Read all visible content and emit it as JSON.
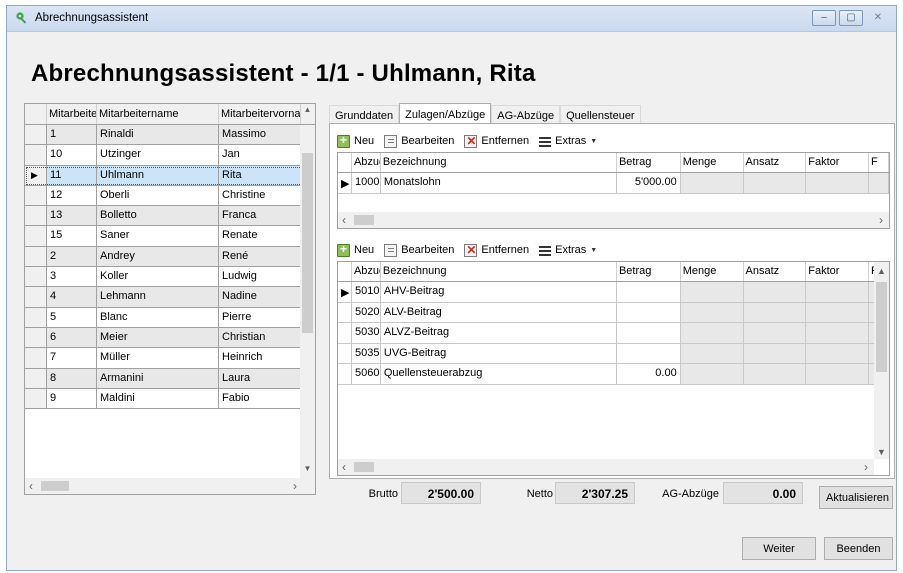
{
  "window": {
    "title": "Abrechnungsassistent",
    "controls": [
      "–",
      "▢",
      "✕"
    ]
  },
  "heading": "Abrechnungsassistent - 1/1 - Uhlmann, Rita",
  "employees": {
    "columns": [
      "Mitarbeiten",
      "Mitarbeitername",
      "Mitarbeitervornam"
    ],
    "rows": [
      {
        "nr": "1",
        "name": "Rinaldi",
        "vorname": "Massimo",
        "alt": true
      },
      {
        "nr": "10",
        "name": "Utzinger",
        "vorname": "Jan",
        "alt": false
      },
      {
        "nr": "11",
        "name": "Uhlmann",
        "vorname": "Rita",
        "selected": true,
        "indicator": "▶"
      },
      {
        "nr": "12",
        "name": "Oberli",
        "vorname": "Christine",
        "alt": false
      },
      {
        "nr": "13",
        "name": "Bolletto",
        "vorname": "Franca",
        "alt": true
      },
      {
        "nr": "15",
        "name": "Saner",
        "vorname": "Renate",
        "alt": false
      },
      {
        "nr": "2",
        "name": "Andrey",
        "vorname": "René",
        "alt": true
      },
      {
        "nr": "3",
        "name": "Koller",
        "vorname": "Ludwig",
        "alt": false
      },
      {
        "nr": "4",
        "name": "Lehmann",
        "vorname": "Nadine",
        "alt": true
      },
      {
        "nr": "5",
        "name": "Blanc",
        "vorname": "Pierre",
        "alt": false
      },
      {
        "nr": "6",
        "name": "Meier",
        "vorname": "Christian",
        "alt": true
      },
      {
        "nr": "7",
        "name": "Müller",
        "vorname": "Heinrich",
        "alt": false
      },
      {
        "nr": "8",
        "name": "Armanini",
        "vorname": "Laura",
        "alt": true
      },
      {
        "nr": "9",
        "name": "Maldini",
        "vorname": "Fabio",
        "alt": false
      }
    ]
  },
  "tabs": [
    {
      "label": "Grunddaten",
      "active": false
    },
    {
      "label": "Zulagen/Abzüge",
      "active": true
    },
    {
      "label": "AG-Abzüge",
      "active": false
    },
    {
      "label": "Quellensteuer",
      "active": false
    }
  ],
  "toolbar": {
    "new": "Neu",
    "edit": "Bearbeiten",
    "remove": "Entfernen",
    "extras": "Extras"
  },
  "grid_columns": [
    "AbzugZi",
    "Bezeichnung",
    "Betrag",
    "Menge",
    "Ansatz",
    "Faktor",
    "F"
  ],
  "zulagen": [
    {
      "code": "1000",
      "bez": "Monatslohn",
      "betrag": "5'000.00",
      "indicator": "▶"
    }
  ],
  "abzuege": [
    {
      "code": "5010",
      "bez": "AHV-Beitrag",
      "betrag": "",
      "indicator": "▶"
    },
    {
      "code": "5020",
      "bez": "ALV-Beitrag",
      "betrag": ""
    },
    {
      "code": "5030",
      "bez": "ALVZ-Beitrag",
      "betrag": ""
    },
    {
      "code": "5035",
      "bez": "UVG-Beitrag",
      "betrag": ""
    },
    {
      "code": "5060",
      "bez": "Quellensteuerabzug",
      "betrag": "0.00"
    }
  ],
  "totals": {
    "brutto_label": "Brutto",
    "brutto": "2'500.00",
    "netto_label": "Netto",
    "netto": "2'307.25",
    "ag_label": "AG-Abzüge",
    "ag": "0.00"
  },
  "buttons": {
    "refresh": "Aktualisieren",
    "next": "Weiter",
    "finish": "Beenden"
  }
}
